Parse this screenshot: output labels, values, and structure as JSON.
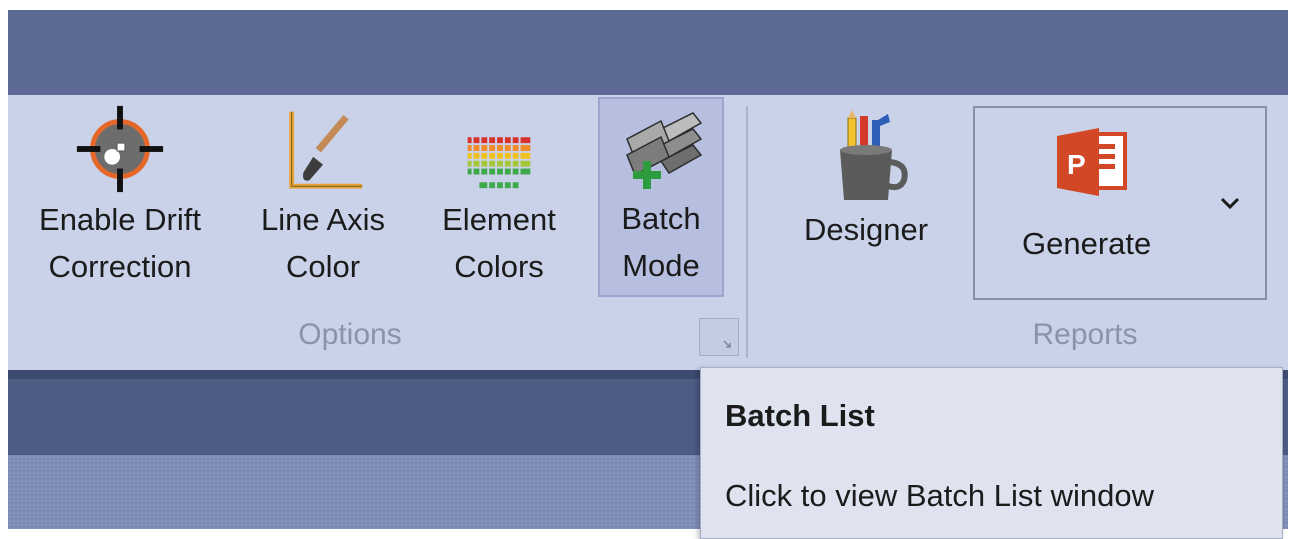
{
  "ribbon": {
    "options_group": {
      "label": "Options",
      "buttons": [
        {
          "line1": "Enable Drift",
          "line2": "Correction",
          "icon": "crosshair-target-icon",
          "state": "normal"
        },
        {
          "line1": "Line Axis",
          "line2": "Color",
          "icon": "axis-paintbrush-icon",
          "state": "normal"
        },
        {
          "line1": "Element",
          "line2": "Colors",
          "icon": "color-bars-icon",
          "state": "normal"
        },
        {
          "line1": "Batch",
          "line2": "Mode",
          "icon": "stacked-layers-add-icon",
          "state": "active"
        }
      ]
    },
    "reports_group": {
      "label": "Reports",
      "designer_label": "Designer",
      "generate_label": "Generate",
      "powerpoint_icon_letter": "P"
    }
  },
  "tooltip": {
    "title": "Batch List",
    "body": "Click to view Batch List window"
  },
  "colors": {
    "ribbon_bg": "#c9d2e8",
    "title_strip": "#5d6a96",
    "active_button": "#b6bfdf",
    "powerpoint_red": "#d24726"
  }
}
